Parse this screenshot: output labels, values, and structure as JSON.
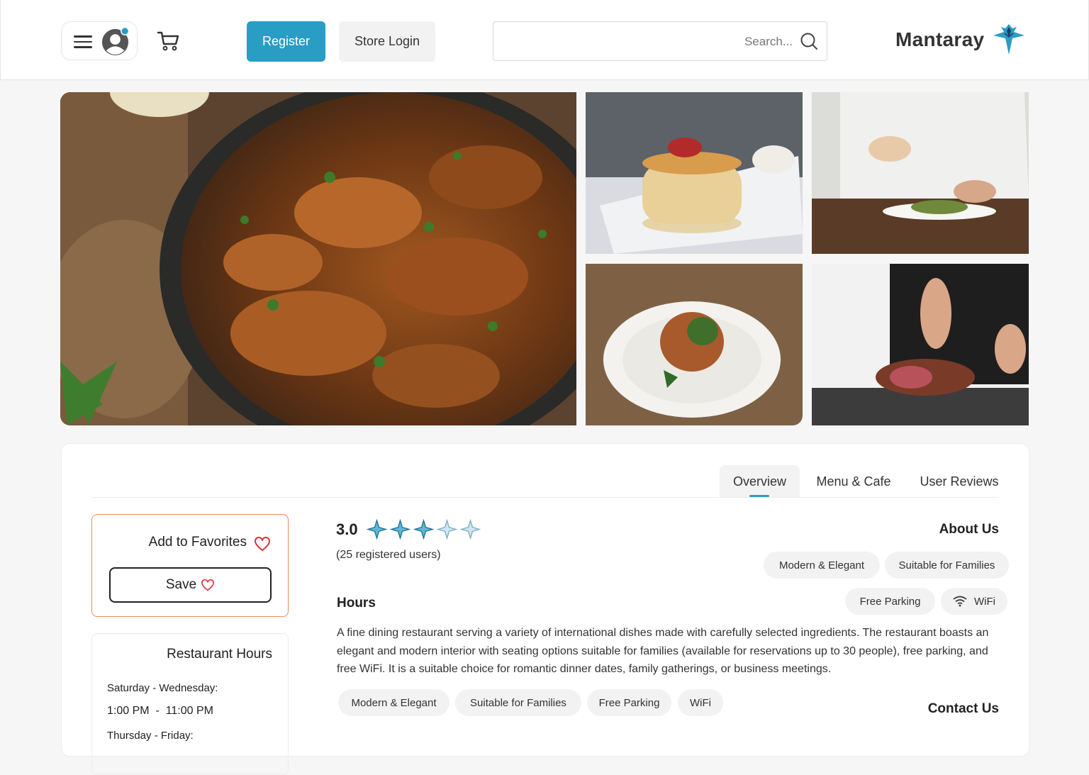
{
  "header": {
    "register_label": "Register",
    "login_label": "Store Login",
    "search_placeholder": "Search...",
    "brand": "Mantaray",
    "accent": "#2a9dc4"
  },
  "gallery": {
    "photos": [
      "grilled-chicken-wings",
      "pancake-stack",
      "chef-plating-dish",
      "salad-plate",
      "chef-slicing-steak"
    ]
  },
  "tabs": [
    {
      "label": "Overview",
      "active": true
    },
    {
      "label": "Menu & Cafe",
      "active": false
    },
    {
      "label": "User Reviews",
      "active": false
    }
  ],
  "favorites": {
    "label": "Add to Favorites",
    "save_label": "Save"
  },
  "restaurant_hours": {
    "title": "Restaurant Hours",
    "days_1": "Saturday - Wednesday:",
    "time_1": "1:00 PM  -  11:00 PM",
    "days_2": "Thursday - Friday:"
  },
  "rating": {
    "value": "3.0",
    "stars_total": 5,
    "stars_filled": 3,
    "users": "(25 registered users)"
  },
  "about": {
    "title": "About Us",
    "chips": [
      "Modern & Elegant",
      "Suitable for Families",
      "Free Parking",
      "WiFi"
    ]
  },
  "hours_section": {
    "title": "Hours",
    "description": "A fine dining restaurant serving a variety of international dishes made with carefully selected ingredients. The restaurant boasts an elegant and modern interior with seating options suitable for families (available for reservations up to 30 people), free parking, and free WiFi. It is a suitable choice for romantic dinner dates, family gatherings, or business meetings.",
    "tags": [
      "Modern & Elegant",
      "Suitable for Families",
      "Free Parking",
      "WiFi"
    ]
  },
  "contact": {
    "title": "Contact Us"
  }
}
